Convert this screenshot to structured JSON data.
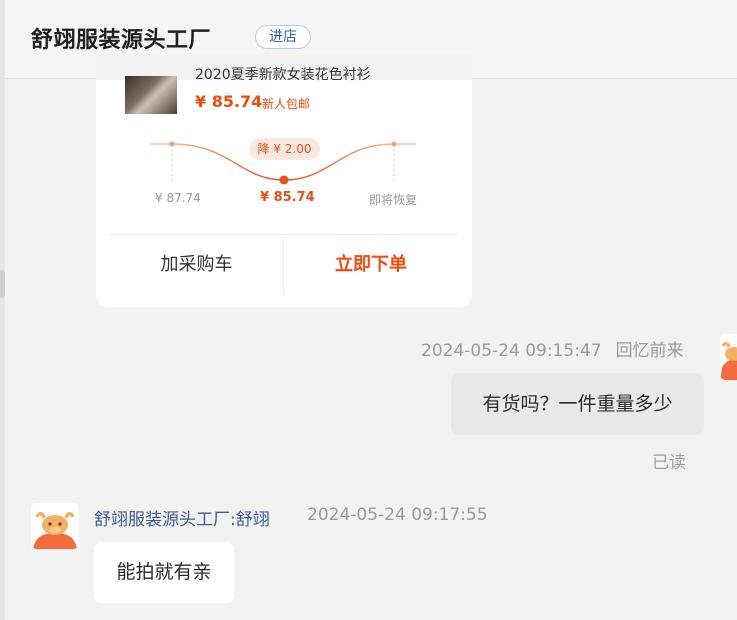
{
  "header": {
    "shop_name": "舒翊服装源头工厂",
    "enter_shop_label": "进店"
  },
  "product_card": {
    "title": "2020夏季新款女装花色衬衫",
    "price": "¥ 85.74",
    "badge": "新人包邮",
    "price_drop": "降 ¥ 2.00",
    "old_price": "¥ 87.74",
    "current_price": "¥ 85.74",
    "restore_label": "即将恢复",
    "add_to_cart_label": "加采购车",
    "order_now_label": "立即下单"
  },
  "messages": {
    "outgoing": {
      "timestamp": "2024-05-24 09:15:47",
      "sender": "回忆前来",
      "text": "有货吗？一件重量多少",
      "status": "已读"
    },
    "incoming": {
      "sender": "舒翊服装源头工厂:舒翊",
      "timestamp": "2024-05-24 09:17:55",
      "text": "能拍就有亲"
    }
  },
  "colors": {
    "accent": "#f04a0c",
    "link": "#2d5fb5",
    "sender_name": "#3d5a96"
  }
}
